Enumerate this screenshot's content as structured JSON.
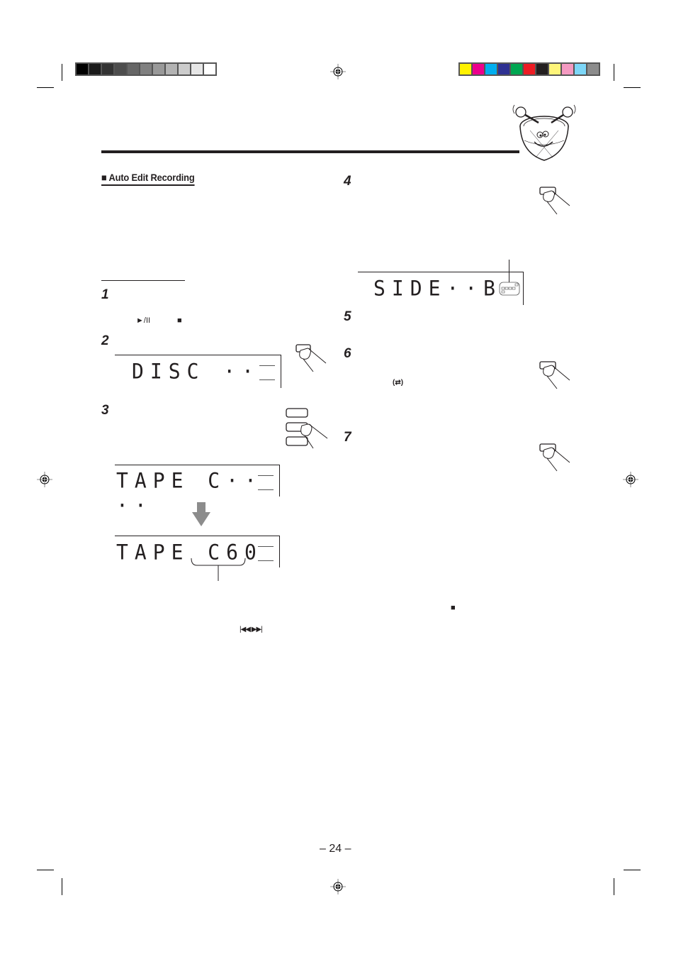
{
  "print_marks": {
    "grayscale_swatches": [
      "#000000",
      "#1a1a1a",
      "#333333",
      "#4d4d4d",
      "#666666",
      "#808080",
      "#999999",
      "#b3b3b3",
      "#cccccc",
      "#e6e6e6",
      "#ffffff"
    ],
    "color_swatches": [
      "#fff200",
      "#ec008c",
      "#00aeef",
      "#2e3192",
      "#00a651",
      "#ed1c24",
      "#231f20",
      "#fff57a",
      "#f49ac1",
      "#7dd6f7",
      "#8c8c8c"
    ]
  },
  "section": {
    "title": "■ Auto Edit Recording"
  },
  "steps": [
    {
      "number": "1",
      "inline_icons": [
        "►/II",
        "■"
      ]
    },
    {
      "number": "2",
      "display": "DISC  ··"
    },
    {
      "number": "3",
      "displays": [
        "TAPE C·· ··",
        "TAPE C60"
      ]
    },
    {
      "number": "4",
      "display": "SIDE··B"
    },
    {
      "number": "5"
    },
    {
      "number": "6",
      "inline_icons": [
        "(⇄)"
      ]
    },
    {
      "number": "7"
    }
  ],
  "skip_icons": "|◀◀  ▶▶|",
  "stop_icon": "■",
  "page_number": "– 24 –"
}
